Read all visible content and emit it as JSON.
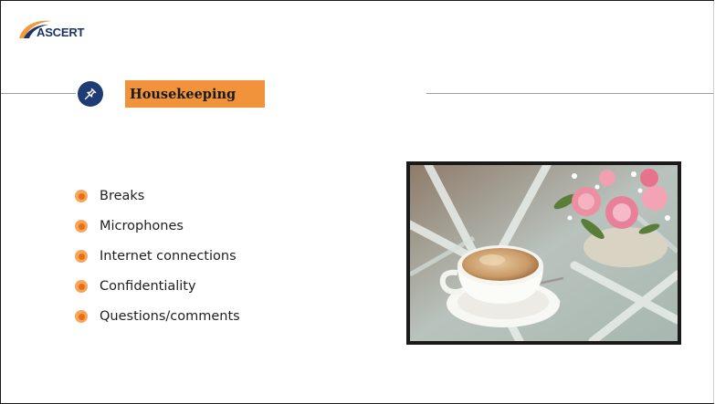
{
  "logo": {
    "text": "ASCERT",
    "icon": "ascert-logo-swoosh"
  },
  "header": {
    "title": "Housekeeping",
    "icon": "pushpin-icon"
  },
  "bullets": [
    {
      "label": "Breaks"
    },
    {
      "label": "Microphones"
    },
    {
      "label": "Internet connections"
    },
    {
      "label": "Confidentiality"
    },
    {
      "label": "Questions/comments"
    }
  ],
  "image": {
    "subject": "coffee-cup-with-roses-photo"
  },
  "colors": {
    "accent_orange": "#f0933a",
    "badge_navy": "#1f3b73",
    "bullet_orange": "#e96d12"
  }
}
